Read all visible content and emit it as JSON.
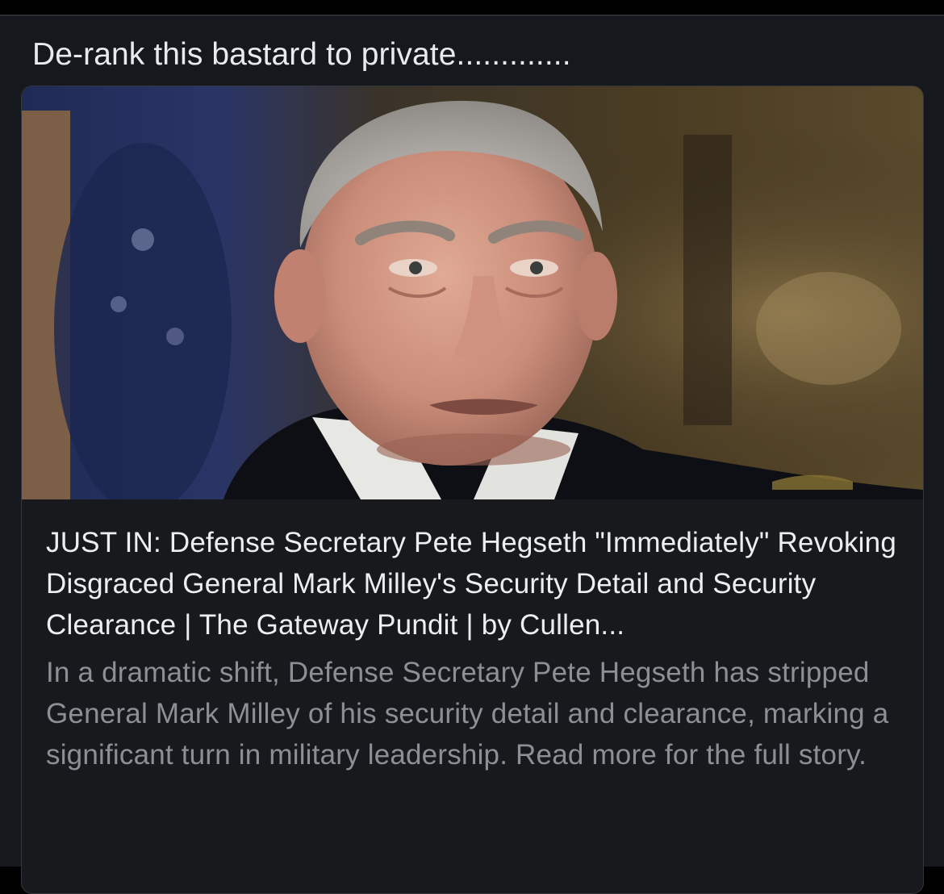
{
  "post": {
    "text": "De-rank this bastard to private............."
  },
  "link_card": {
    "image_description_icon": "news-photo",
    "title": "JUST IN: Defense Secretary Pete Hegseth \"Immediately\" Revoking Disgraced General Mark Milley's Security Detail and Security Clearance | The Gateway Pundit | by Cullen...",
    "description": "In a dramatic shift, Defense Secretary Pete Hegseth has stripped General Mark Milley of his security detail and clearance, marking a significant turn in military leadership. Read more for the full story."
  },
  "colors": {
    "background": "#000000",
    "card_surface": "#15181c",
    "title_text": "#eceef0",
    "description_text": "#8b9096"
  }
}
